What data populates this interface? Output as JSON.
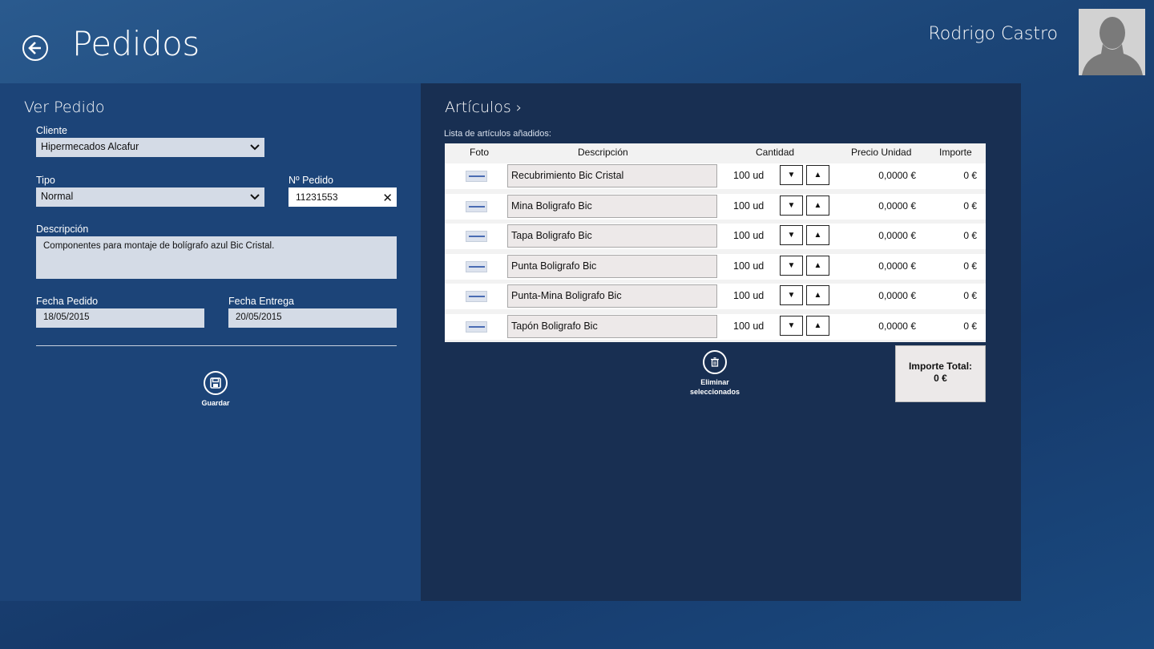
{
  "header": {
    "title": "Pedidos",
    "user_name": "Rodrigo Castro"
  },
  "form": {
    "section_title": "Ver Pedido",
    "cliente_label": "Cliente",
    "cliente_value": "Hipermecados Alcafur",
    "tipo_label": "Tipo",
    "tipo_value": "Normal",
    "pedido_label": "Nº Pedido",
    "pedido_value": "11231553",
    "descripcion_label": "Descripción",
    "descripcion_value": "Componentes para montaje de bolígrafo azul Bic Cristal.",
    "fecha_pedido_label": "Fecha Pedido",
    "fecha_pedido_value": "18/05/2015",
    "fecha_entrega_label": "Fecha Entrega",
    "fecha_entrega_value": "20/05/2015",
    "save_label": "Guardar"
  },
  "articles": {
    "title": "Artículos",
    "list_label": "Lista de artículos añadidos:",
    "columns": {
      "foto": "Foto",
      "descripcion": "Descripción",
      "cantidad": "Cantidad",
      "precio": "Precio Unidad",
      "importe": "Importe"
    },
    "rows": [
      {
        "descripcion": "Recubrimiento  Bic Cristal",
        "cantidad": "100 ud",
        "precio": "0,0000 €",
        "importe": "0 €"
      },
      {
        "descripcion": "Mina Boligrafo Bic",
        "cantidad": "100 ud",
        "precio": "0,0000 €",
        "importe": "0 €"
      },
      {
        "descripcion": "Tapa Boligrafo Bic",
        "cantidad": "100 ud",
        "precio": "0,0000 €",
        "importe": "0 €"
      },
      {
        "descripcion": "Punta Boligrafo Bic",
        "cantidad": "100 ud",
        "precio": "0,0000 €",
        "importe": "0 €"
      },
      {
        "descripcion": "Punta-Mina Boligrafo Bic",
        "cantidad": "100 ud",
        "precio": "0,0000 €",
        "importe": "0 €"
      },
      {
        "descripcion": "Tapón Boligrafo Bic",
        "cantidad": "100 ud",
        "precio": "0,0000 €",
        "importe": "0 €"
      }
    ],
    "delete_label_line1": "Eliminar",
    "delete_label_line2": "seleccionados",
    "total_label": "Importe Total:",
    "total_value": "0 €"
  }
}
